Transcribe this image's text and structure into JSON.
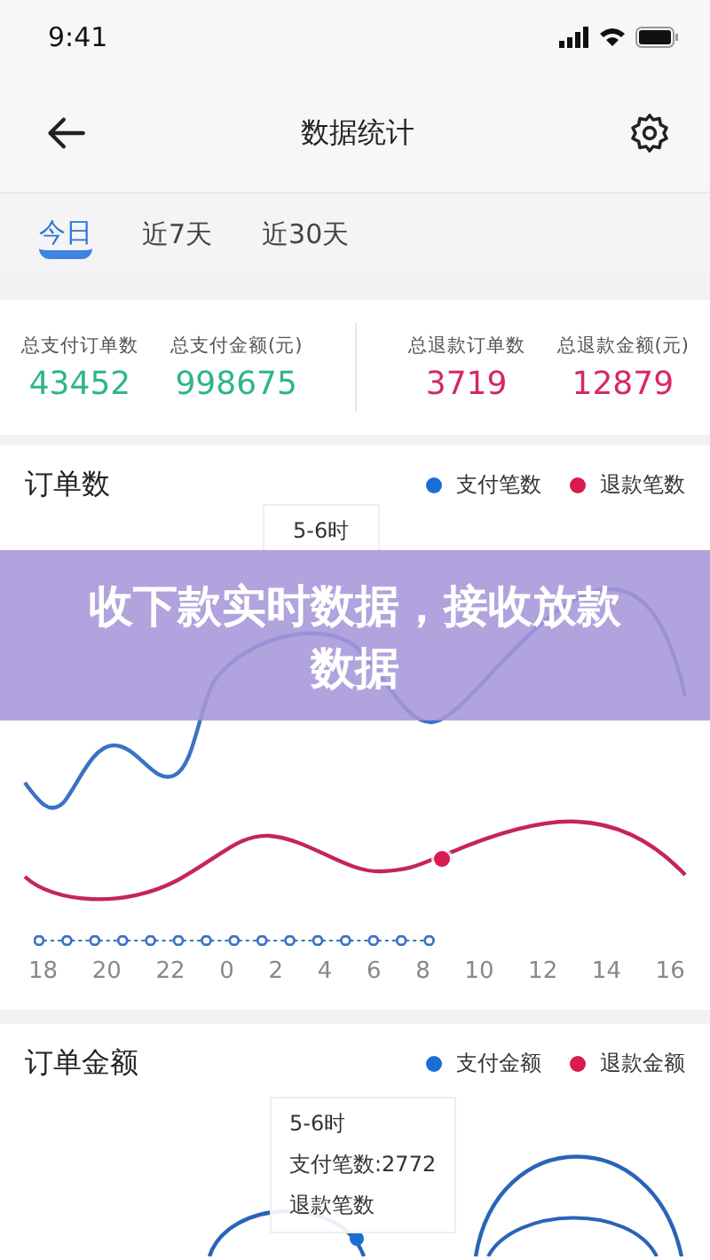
{
  "status_bar": {
    "time": "9:41"
  },
  "header": {
    "title": "数据统计"
  },
  "tabs": [
    {
      "label": "今日",
      "selected": true
    },
    {
      "label": "近7天",
      "selected": false
    },
    {
      "label": "近30天",
      "selected": false
    }
  ],
  "stats": [
    {
      "label": "总支付订单数",
      "value": "43452",
      "kind": "pay"
    },
    {
      "label": "总支付金额(元)",
      "value": "998675",
      "kind": "pay"
    },
    {
      "label": "总退款订单数",
      "value": "3719",
      "kind": "refund"
    },
    {
      "label": "总退款金额(元)",
      "value": "12879",
      "kind": "refund"
    }
  ],
  "charts": [
    {
      "title": "订单数",
      "legend": [
        {
          "label": "支付笔数",
          "color": "#1a6fd6"
        },
        {
          "label": "退款笔数",
          "color": "#d81b50"
        }
      ],
      "tooltip": [
        "5-6时"
      ],
      "x_labels": [
        "18",
        "20",
        "22",
        "0",
        "2",
        "4",
        "6",
        "8",
        "10",
        "12",
        "14",
        "16"
      ]
    },
    {
      "title": "订单金额",
      "legend": [
        {
          "label": "支付金额",
          "color": "#1a6fd6"
        },
        {
          "label": "退款金额",
          "color": "#d81b50"
        }
      ],
      "tooltip": [
        "5-6时",
        "支付笔数:2772",
        "退款笔数"
      ]
    }
  ],
  "banner": "收下款实时数据，接收放款数据"
}
